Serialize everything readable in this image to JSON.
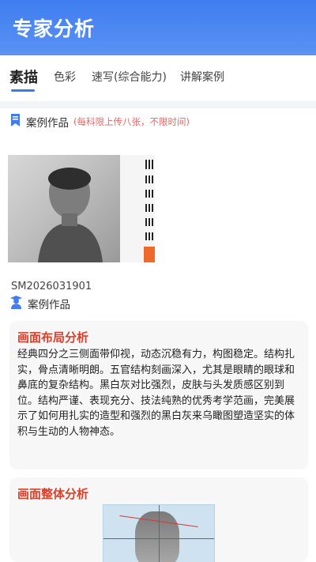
{
  "header": {
    "title": "专家分析"
  },
  "tabs": [
    {
      "label": "素描",
      "active": true
    },
    {
      "label": "色彩"
    },
    {
      "label": "速写(综合能力)"
    },
    {
      "label": "讲解案例"
    }
  ],
  "section": {
    "label": "案例作品",
    "hint": "(每科限上传八张，不限时间)"
  },
  "artwork": {
    "code": "SM2026031901"
  },
  "case_label": "案例作品",
  "cards": [
    {
      "title": "画面布局分析",
      "body": "经典四分之三侧面带仰视，动态沉稳有力，构图稳定。结构扎实，骨点清晰明朗。五官结构刻画深入，尤其是眼睛的眼球和鼻底的复杂结构。黑白灰对比强烈，皮肤与头发质感区别到位。结构严谨、表现充分、技法纯熟的优秀考学范画，完美展示了如何用扎实的造型和强烈的黑白灰来乌瞰图塑造坚实的体积与生动的人物神态。"
    },
    {
      "title": "画面整体分析"
    }
  ],
  "colors": {
    "primary": "#3f7df0",
    "accent_red": "#d9402c"
  }
}
